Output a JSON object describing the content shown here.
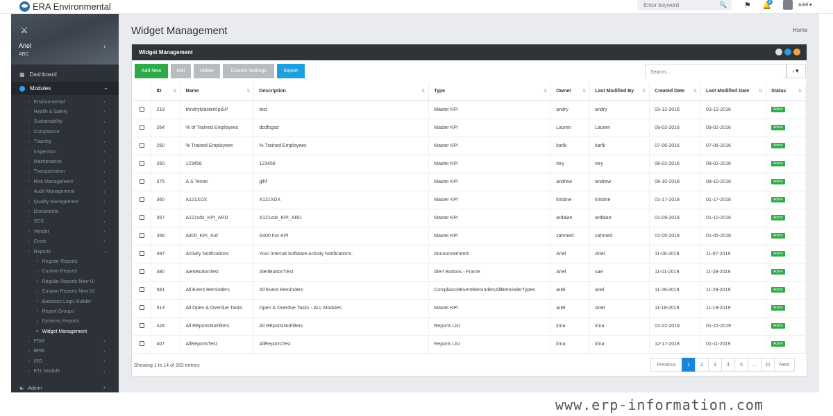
{
  "header": {
    "brand": "ERA Environmental",
    "search_placeholder": "Enter keyword",
    "notification_count": "2",
    "user_label": "Ariel ▾"
  },
  "sidebar": {
    "user": {
      "name": "Ariel",
      "org": "ABC"
    },
    "dashboard": "Dashboard",
    "modules": "Modules",
    "items": [
      {
        "label": "Environmental",
        "kind": "module",
        "has_chevron": true
      },
      {
        "label": "Health & Safety",
        "kind": "module",
        "has_chevron": true
      },
      {
        "label": "Sustainability",
        "kind": "module",
        "has_chevron": true
      },
      {
        "label": "Compliance",
        "kind": "module",
        "has_chevron": true
      },
      {
        "label": "Training",
        "kind": "module",
        "has_chevron": true
      },
      {
        "label": "Inspection",
        "kind": "module",
        "has_chevron": true
      },
      {
        "label": "Maintenance",
        "kind": "module",
        "has_chevron": true
      },
      {
        "label": "Transportation",
        "kind": "module",
        "has_chevron": true
      },
      {
        "label": "Risk Management",
        "kind": "module",
        "has_chevron": true
      },
      {
        "label": "Audit Management",
        "kind": "module",
        "has_chevron": true
      },
      {
        "label": "Quality Management",
        "kind": "module",
        "has_chevron": true
      },
      {
        "label": "Documents",
        "kind": "module",
        "has_chevron": true
      },
      {
        "label": "SDS",
        "kind": "module",
        "has_chevron": true
      },
      {
        "label": "Vendor",
        "kind": "module",
        "has_chevron": true
      },
      {
        "label": "Costs",
        "kind": "module",
        "has_chevron": true
      },
      {
        "label": "Reports",
        "kind": "module",
        "has_chevron": true,
        "expanded": true
      },
      {
        "label": "Regular Reports",
        "kind": "child"
      },
      {
        "label": "Custom Reports",
        "kind": "child"
      },
      {
        "label": "Regular Reports New UI",
        "kind": "child"
      },
      {
        "label": "Custom Reports New UI",
        "kind": "child"
      },
      {
        "label": "Business Logic Builder",
        "kind": "child"
      },
      {
        "label": "Report Groups",
        "kind": "child"
      },
      {
        "label": "Dynamic Reports",
        "kind": "child"
      },
      {
        "label": "Widget Management",
        "kind": "child",
        "active": true
      },
      {
        "label": "PSM",
        "kind": "module",
        "has_chevron": true
      },
      {
        "label": "BPM",
        "kind": "module",
        "has_chevron": true
      },
      {
        "label": "ISO",
        "kind": "module",
        "has_chevron": true
      },
      {
        "label": "ETL Module",
        "kind": "module",
        "has_chevron": true
      }
    ],
    "admin": "Admin"
  },
  "page": {
    "title": "Widget Management",
    "breadcrumb": "Home",
    "panel_title": "Widget Management"
  },
  "toolbar": {
    "add": "Add New",
    "edit": "Edit",
    "delete": "Delete",
    "custom": "Custom Settings",
    "export": "Export",
    "search_placeholder": "Search..."
  },
  "table": {
    "columns": [
      "ID",
      "Name",
      "Description",
      "Type",
      "Owner",
      "Last Modified By",
      "Created Date",
      "Last Modified Date",
      "Status"
    ],
    "rows": [
      [
        "219",
        "tAndryMasterKpiSP",
        "test",
        "Master KPI",
        "andry",
        "andry",
        "03-12-2016",
        "03-12-2016",
        "Active"
      ],
      [
        "264",
        "% of Trained Employees",
        "dcdfsgsd",
        "Master KPI",
        "Lauren",
        "Lauren",
        "09-02-2016",
        "09-02-2016",
        "Active"
      ],
      [
        "250",
        "% Trained Employees",
        "% Trained Employees",
        "Master KPI",
        "karlk",
        "karlk",
        "07-06-2016",
        "07-06-2016",
        "Active"
      ],
      [
        "260",
        "123456",
        "123456",
        "Master KPI",
        "mry",
        "mry",
        "08-02-2016",
        "08-02-2016",
        "Active"
      ],
      [
        "375",
        "A.S Tester",
        "glhf",
        "Master KPI",
        "andrew",
        "andrew",
        "08-10-2018",
        "08-10-2018",
        "Active"
      ],
      [
        "360",
        "A121XDX",
        "A121XDX",
        "Master KPI",
        "kristine",
        "kristine",
        "01-17-2018",
        "01-17-2018",
        "Active"
      ],
      [
        "357",
        "A121xdx_KPI_ARD",
        "A121xdx_KPI_ARD",
        "Master KPI",
        "ardalan",
        "ardalan",
        "01-09-2018",
        "01-10-2018",
        "Active"
      ],
      [
        "356",
        "A400_KPI_Ard",
        "A400 For KPI",
        "Master KPI",
        "zahmed",
        "zahmed",
        "01-05-2018",
        "01-05-2018",
        "Active"
      ],
      [
        "487",
        "Activity Notifications",
        "Your Internal Software Activity Notifications.",
        "Announcements",
        "Ariel",
        "Ariel",
        "11-06-2019",
        "11-07-2019",
        "Active"
      ],
      [
        "480",
        "AlertButtonTest",
        "AlertButtonTEst",
        "Alert Buttons - Frame",
        "Ariel",
        "sae",
        "11-01-2019",
        "11-28-2019",
        "Active"
      ],
      [
        "581",
        "All Event Reminders",
        "All Event Reminders",
        "ComplianceEventRemindersAllReminderTypes",
        "ariel",
        "ariel",
        "11-29-2019",
        "11-29-2019",
        "Active"
      ],
      [
        "513",
        "All Open & Overdue Tasks",
        "Open & Overdue Tasks - ALL Modules",
        "Master KPI",
        "ariel",
        "Ariel",
        "11-18-2019",
        "11-19-2019",
        "Active"
      ],
      [
        "424",
        "All REportsNoFilters",
        "All REportsNoFilters",
        "Reports List",
        "irina",
        "irina",
        "01-22-2019",
        "01-22-2019",
        "Active"
      ],
      [
        "407",
        "AllReportsTest",
        "AllReportsTest",
        "Reports List",
        "irina",
        "irina",
        "12-17-2018",
        "01-11-2019",
        "Active"
      ]
    ]
  },
  "footer": {
    "showing": "Showing 1 to 14 of 283 entries",
    "prev": "Previous",
    "pages": [
      "1",
      "2",
      "3",
      "4",
      "5",
      "...",
      "21"
    ],
    "current_page": "1",
    "next": "Next"
  },
  "watermark": "www.erp-information.com",
  "colors": {
    "accent": "#2faa48",
    "primary": "#1a86d9",
    "sidebar": "#2d3239",
    "panel_header": "#2f3439"
  }
}
